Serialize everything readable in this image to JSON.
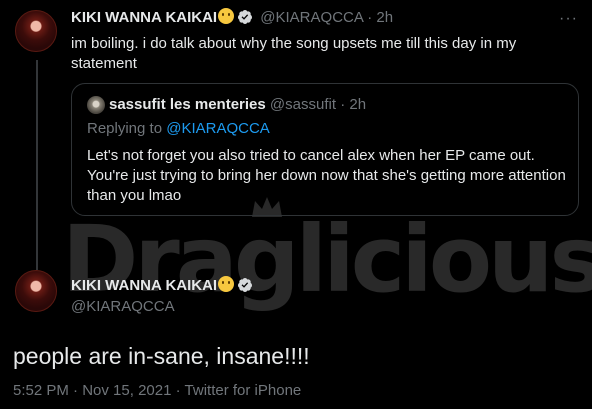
{
  "watermark": {
    "text": "Draglicious"
  },
  "reply_tweet": {
    "display_name": "KIKI WANNA KAIKAI",
    "handle": "@KIARAQCCA",
    "time": "2h",
    "text": "im boiling. i do talk about why the song upsets me till this day in my statement",
    "more_label": "···"
  },
  "quoted_tweet": {
    "display_name": "sassufit les menteries",
    "handle": "@sassufit",
    "time": "2h",
    "replying_prefix": "Replying to",
    "replying_to": "@KIARAQCCA",
    "text": "Let's not forget you also tried to cancel alex when her EP came out. You're just trying to bring her down now that she's getting more attention than you lmao"
  },
  "main_tweet": {
    "display_name": "KIKI WANNA KAIKAI",
    "handle": "@KIARAQCCA",
    "text": "people are in-sane, insane!!!!",
    "time": "5:52 PM",
    "date": "Nov 15, 2021",
    "client": "Twitter for iPhone",
    "separator": "·"
  },
  "colors": {
    "background": "#000000",
    "text": "#e7e9ea",
    "muted": "#71767b",
    "link": "#1d9bf0",
    "border": "#2f3336"
  },
  "icons": [
    "verified-badge-icon",
    "face-emoji-icon",
    "more-options-icon",
    "crown-icon"
  ]
}
